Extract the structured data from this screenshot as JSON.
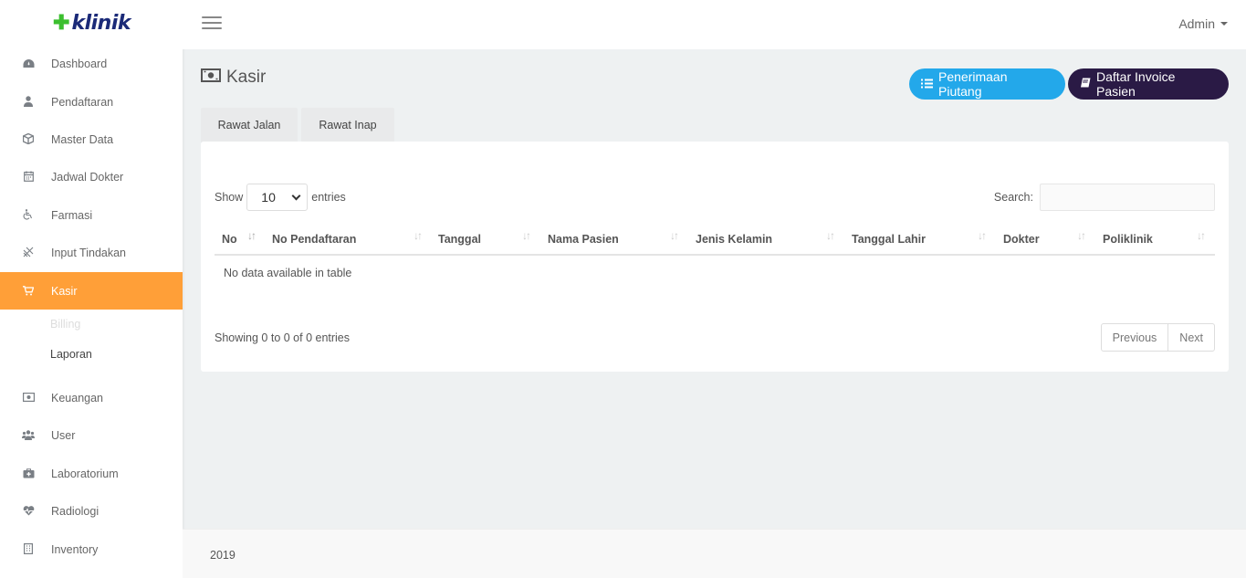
{
  "brand": {
    "cross": "✚",
    "name": "klinik"
  },
  "user": {
    "name": "Admin"
  },
  "sidebar": {
    "items": [
      {
        "label": "Dashboard",
        "icon": "tachometer-icon"
      },
      {
        "label": "Pendaftaran",
        "icon": "user-icon"
      },
      {
        "label": "Master Data",
        "icon": "cube-icon"
      },
      {
        "label": "Jadwal Dokter",
        "icon": "calendar-icon"
      },
      {
        "label": "Farmasi",
        "icon": "wheelchair-icon"
      },
      {
        "label": "Input Tindakan",
        "icon": "stethoscope-icon"
      },
      {
        "label": "Kasir",
        "icon": "cart-icon"
      },
      {
        "label": "Keuangan",
        "icon": "money-icon"
      },
      {
        "label": "User",
        "icon": "users-icon"
      },
      {
        "label": "Laboratorium",
        "icon": "medkit-icon"
      },
      {
        "label": "Radiologi",
        "icon": "heartbeat-icon"
      },
      {
        "label": "Inventory",
        "icon": "building-icon"
      }
    ],
    "kasir_sub": [
      {
        "label": "Billing"
      },
      {
        "label": "Laporan"
      }
    ]
  },
  "page": {
    "title": "Kasir",
    "btn_piutang": "Penerimaan Piutang",
    "btn_invoice": "Daftar Invoice Pasien",
    "tabs": [
      "Rawat Jalan",
      "Rawat Inap"
    ]
  },
  "table": {
    "show_label": "Show",
    "entries_label": "entries",
    "page_size": "10",
    "search_label": "Search:",
    "columns": [
      "No",
      "No Pendaftaran",
      "Tanggal",
      "Nama Pasien",
      "Jenis Kelamin",
      "Tanggal Lahir",
      "Dokter",
      "Poliklinik"
    ],
    "empty": "No data available in table",
    "info": "Showing 0 to 0 of 0 entries",
    "prev": "Previous",
    "next": "Next"
  },
  "footer": {
    "year": "2019"
  },
  "colors": {
    "accent": "#ff9f38",
    "blue": "#23a8ea",
    "dark": "#2a1a45",
    "brand_green": "#3bbf2e",
    "brand_navy": "#1b2a78"
  }
}
